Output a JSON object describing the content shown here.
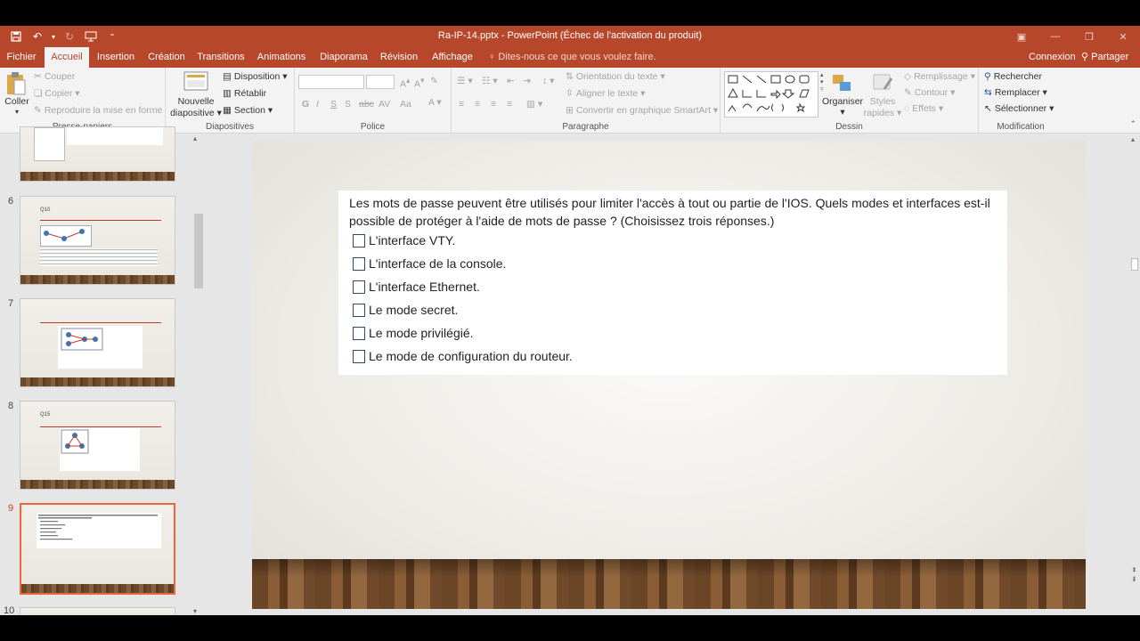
{
  "window": {
    "title": "Ra-IP-14.pptx - PowerPoint (Échec de l'activation du produit)"
  },
  "tabs": [
    "Fichier",
    "Accueil",
    "Insertion",
    "Création",
    "Transitions",
    "Animations",
    "Diaporama",
    "Révision",
    "Affichage"
  ],
  "tell_me": "Dites-nous ce que vous voulez faire.",
  "account": {
    "connexion": "Connexion",
    "partager": "Partager"
  },
  "ribbon": {
    "clipboard": {
      "paste": "Coller",
      "cut": "Couper",
      "copy": "Copier",
      "format_painter": "Reproduire la mise en forme",
      "label": "Presse-papiers"
    },
    "slides": {
      "new_slide_line1": "Nouvelle",
      "new_slide_line2": "diapositive",
      "layout": "Disposition",
      "reset": "Rétablir",
      "section": "Section",
      "label": "Diapositives"
    },
    "font": {
      "bold": "G",
      "italic": "I",
      "underline": "S",
      "strike": "S",
      "label": "Police"
    },
    "paragraph": {
      "text_direction": "Orientation du texte",
      "align_text": "Aligner le texte",
      "smartart": "Convertir en graphique SmartArt",
      "label": "Paragraphe"
    },
    "drawing": {
      "arrange": "Organiser",
      "quick_styles_line1": "Styles",
      "quick_styles_line2": "rapides",
      "fill": "Remplissage",
      "outline": "Contour",
      "effects": "Effets",
      "label": "Dessin"
    },
    "editing": {
      "find": "Rechercher",
      "replace": "Remplacer",
      "select": "Sélectionner",
      "label": "Modification"
    }
  },
  "thumbnails": [
    {
      "number": "",
      "qlabel": ""
    },
    {
      "number": "6",
      "qlabel": "Q10"
    },
    {
      "number": "7",
      "qlabel": ""
    },
    {
      "number": "8",
      "qlabel": "Q15"
    },
    {
      "number": "9",
      "qlabel": ""
    },
    {
      "number": "10",
      "qlabel": ""
    }
  ],
  "slide": {
    "question": "Les mots de passe peuvent être utilisés pour limiter l'accès à tout ou partie de l'IOS. Quels modes et interfaces est-il possible de protéger à l'aide de mots de passe ? (Choisissez trois réponses.)",
    "options": [
      "L'interface VTY.",
      "L'interface de la console.",
      "L'interface Ethernet.",
      "Le mode secret.",
      "Le mode privilégié.",
      "Le mode de configuration du routeur."
    ]
  },
  "colors": {
    "accent": "#b7472a",
    "selected_thumb_border": "#e8683b"
  }
}
